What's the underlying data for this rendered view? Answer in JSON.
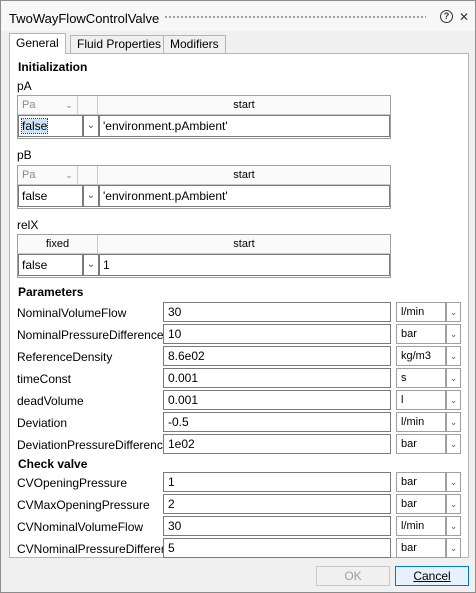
{
  "window": {
    "title": "TwoWayFlowControlValve"
  },
  "tabs": [
    {
      "label": "General",
      "active": true
    },
    {
      "label": "Fluid Properties",
      "active": false
    },
    {
      "label": "Modifiers",
      "active": false
    }
  ],
  "init": {
    "heading": "Initialization",
    "pA": {
      "label": "pA",
      "col1": "Pa",
      "col2": "start",
      "value": "false",
      "start": "'environment.pAmbient'"
    },
    "pB": {
      "label": "pB",
      "col1": "Pa",
      "col2": "start",
      "value": "false",
      "start": "'environment.pAmbient'"
    },
    "relX": {
      "label": "relX",
      "col1": "fixed",
      "col2": "start",
      "value": "false",
      "start": "1"
    }
  },
  "parameters": {
    "heading": "Parameters",
    "rows": [
      {
        "label": "NominalVolumeFlow",
        "value": "30",
        "unit": "l/min"
      },
      {
        "label": "NominalPressureDifference",
        "value": "10",
        "unit": "bar"
      },
      {
        "label": "ReferenceDensity",
        "value": "8.6e02",
        "unit": "kg/m3"
      },
      {
        "label": "timeConst",
        "value": "0.001",
        "unit": "s"
      },
      {
        "label": "deadVolume",
        "value": "0.001",
        "unit": "l"
      },
      {
        "label": "Deviation",
        "value": "-0.5",
        "unit": "l/min"
      },
      {
        "label": "DeviationPressureDifference",
        "value": "1e02",
        "unit": "bar"
      }
    ]
  },
  "check_valve": {
    "heading": "Check valve",
    "rows": [
      {
        "label": "CVOpeningPressure",
        "value": "1",
        "unit": "bar"
      },
      {
        "label": "CVMaxOpeningPressure",
        "value": "2",
        "unit": "bar"
      },
      {
        "label": "CVNominalVolumeFlow",
        "value": "30",
        "unit": "l/min"
      },
      {
        "label": "CVNominalPressureDifference",
        "value": "5",
        "unit": "bar"
      }
    ]
  },
  "buttons": {
    "ok": "OK",
    "cancel": "Cancel"
  },
  "icons": {
    "help": "help-icon",
    "close": "close-icon",
    "dropdown": "chevron-down-icon",
    "grip": "drag-grip-icon"
  }
}
